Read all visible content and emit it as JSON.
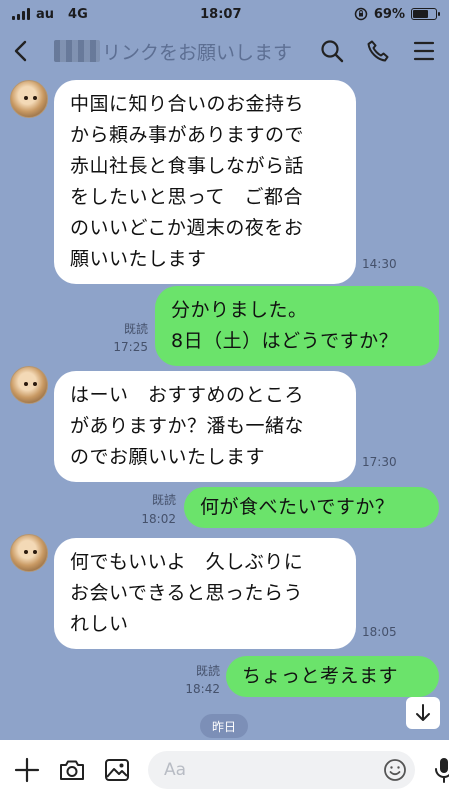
{
  "status": {
    "carrier": "au",
    "network": "4G",
    "time": "18:07",
    "battery": "69%",
    "battery_level": 0.69
  },
  "header": {
    "title": "リンクをお願いします"
  },
  "messages": [
    {
      "side": "in",
      "text_lines": [
        "中国に知り合いのお金持ち",
        "から頼み事がありますので",
        "赤山社長と食事しながら話",
        "をしたいと思って　ご都合",
        "のいいどこか週末の夜をお",
        "願いいたします"
      ],
      "time": "14:30"
    },
    {
      "side": "out",
      "text_lines": [
        "分かりました。",
        "8日（土）はどうですか？"
      ],
      "read": "既読",
      "time": "17:25"
    },
    {
      "side": "in",
      "text_lines": [
        "はーい　おすすめのところ",
        "がありますか？潘も一緒な",
        "のでお願いいたします"
      ],
      "time": "17:30"
    },
    {
      "side": "out",
      "text_lines": [
        "何が食べたいですか？"
      ],
      "read": "既読",
      "time": "18:02"
    },
    {
      "side": "in",
      "text_lines": [
        "何でもいいよ　久しぶりに",
        "お会いできると思ったらう",
        "れしい"
      ],
      "time": "18:05"
    },
    {
      "side": "out",
      "text_lines": [
        "ちょっと考えます"
      ],
      "read": "既読",
      "time": "18:42"
    }
  ],
  "date_chip": "昨日",
  "input": {
    "placeholder": "Aa"
  },
  "colors": {
    "background": "#8ea3c9",
    "outgoing": "#6be36b",
    "incoming": "#ffffff"
  },
  "icons": [
    "back-icon",
    "search-icon",
    "phone-icon",
    "menu-icon",
    "plus-icon",
    "camera-icon",
    "image-icon",
    "emoji-icon",
    "mic-icon",
    "arrow-down-icon"
  ]
}
